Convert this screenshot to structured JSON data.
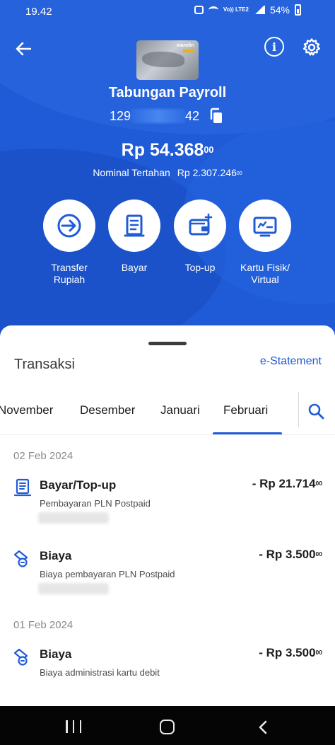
{
  "status_bar": {
    "time": "19.42",
    "battery": "54%",
    "network": "Vo)) LTE2"
  },
  "header": {
    "card_brand": "mandiri",
    "account_name": "Tabungan Payroll",
    "account_number_prefix": "129",
    "account_number_suffix": "42",
    "balance_main": "Rp 54.368",
    "balance_decimal": "00",
    "held_label": "Nominal Tertahan",
    "held_amount_main": "Rp 2.307.246",
    "held_amount_decimal": "00"
  },
  "quick_actions": [
    {
      "label_line1": "Transfer",
      "label_line2": "Rupiah",
      "icon": "transfer-icon"
    },
    {
      "label_line1": "Bayar",
      "label_line2": "",
      "icon": "bill-icon"
    },
    {
      "label_line1": "Top-up",
      "label_line2": "",
      "icon": "wallet-topup-icon"
    },
    {
      "label_line1": "Kartu Fisik/",
      "label_line2": "Virtual",
      "icon": "card-icon"
    }
  ],
  "transactions_section": {
    "title": "Transaksi",
    "estatement_label": "e-Statement",
    "months": [
      "November",
      "Desember",
      "Januari",
      "Februari"
    ],
    "selected_month": "Februari",
    "groups": [
      {
        "date": "02 Feb 2024",
        "items": [
          {
            "title": "Bayar/Top-up",
            "amount_main": "- Rp 21.714",
            "amount_decimal": "00",
            "description": "Pembayaran PLN Postpaid",
            "icon": "receipt-icon"
          },
          {
            "title": "Biaya",
            "amount_main": "- Rp 3.500",
            "amount_decimal": "00",
            "description": "Biaya pembayaran PLN Postpaid",
            "icon": "fee-icon"
          }
        ]
      },
      {
        "date": "01 Feb 2024",
        "items": [
          {
            "title": "Biaya",
            "amount_main": "- Rp 3.500",
            "amount_decimal": "00",
            "description": "Biaya administrasi kartu debit",
            "icon": "fee-icon"
          }
        ]
      }
    ]
  },
  "colors": {
    "primary": "#1f5bd6",
    "text_dark": "#1e1e1e",
    "text_muted": "#8a8a8a"
  }
}
